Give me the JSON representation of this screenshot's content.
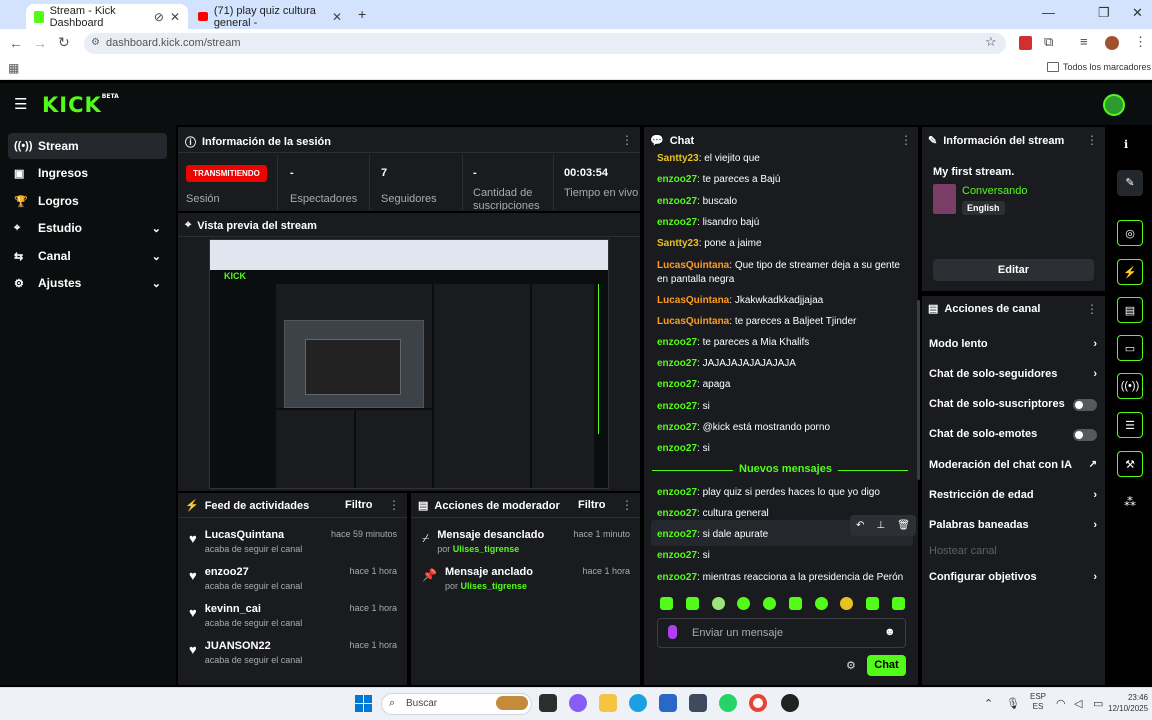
{
  "browser": {
    "tabs": [
      {
        "title": "Stream - Kick Dashboard"
      },
      {
        "title": "(71) play quiz cultura general -"
      }
    ],
    "url": "dashboard.kick.com/stream",
    "bookmarks_label": "Todos los marcadores"
  },
  "kick": {
    "logo": "KICK",
    "beta": "BETA"
  },
  "nav": [
    {
      "label": "Stream",
      "icon": "stream-icon"
    },
    {
      "label": "Ingresos",
      "icon": "revenue-icon"
    },
    {
      "label": "Logros",
      "icon": "trophy-icon"
    },
    {
      "label": "Estudio",
      "icon": "studio-icon"
    },
    {
      "label": "Canal",
      "icon": "channel-icon"
    },
    {
      "label": "Ajustes",
      "icon": "gear-icon"
    }
  ],
  "session": {
    "title": "Información de la sesión",
    "status_badge": "TRANSMITIENDO",
    "status_label": "Sesión",
    "stats": [
      {
        "value": "-",
        "label": "Espectadores"
      },
      {
        "value": "7",
        "label": "Seguidores"
      },
      {
        "value": "-",
        "label": "Cantidad de suscripciones"
      },
      {
        "value": "00:03:54",
        "label": "Tiempo en vivo"
      }
    ]
  },
  "preview": {
    "title": "Vista previa del stream"
  },
  "feed": {
    "title": "Feed de actividades",
    "filter": "Filtro",
    "items": [
      {
        "name": "LucasQuintana",
        "sub": "acaba de seguir el canal",
        "time": "hace 59 minutos"
      },
      {
        "name": "enzoo27",
        "sub": "acaba de seguir el canal",
        "time": "hace 1 hora"
      },
      {
        "name": "kevinn_cai",
        "sub": "acaba de seguir el canal",
        "time": "hace 1 hora"
      },
      {
        "name": "JUANSON22",
        "sub": "acaba de seguir el canal",
        "time": "hace 1 hora"
      }
    ]
  },
  "mod": {
    "title": "Acciones de moderador",
    "filter": "Filtro",
    "items": [
      {
        "action": "Mensaje desanclado",
        "by": "por",
        "user": "Ulises_tigrense",
        "time": "hace 1 minuto"
      },
      {
        "action": "Mensaje anclado",
        "by": "por",
        "user": "Ulises_tigrense",
        "time": "hace 1 hora"
      }
    ]
  },
  "chat": {
    "title": "Chat",
    "messages": [
      {
        "user": "Santty23",
        "text": "el viejito que"
      },
      {
        "user": "enzoo27",
        "text": "te pareces a Bajú"
      },
      {
        "user": "enzoo27",
        "text": "buscalo"
      },
      {
        "user": "enzoo27",
        "text": "lisandro bajú"
      },
      {
        "user": "Santty23",
        "text": "pone a jaime"
      },
      {
        "user": "LucasQuintana",
        "text": "Que tipo de streamer deja a su gente en pantalla negra"
      },
      {
        "user": "LucasQuintana",
        "text": "Jkakwkadkkadjjajaa"
      },
      {
        "user": "LucasQuintana",
        "text": "te pareces a Baljeet Tjinder"
      },
      {
        "user": "enzoo27",
        "text": "te pareces a Mia Khalifs"
      },
      {
        "user": "enzoo27",
        "text": "JAJAJAJAJAJAJAJA"
      },
      {
        "user": "enzoo27",
        "text": "apaga"
      },
      {
        "user": "enzoo27",
        "text": "si"
      },
      {
        "user": "enzoo27",
        "text": "@kick está mostrando porno"
      },
      {
        "user": "enzoo27",
        "text": "si"
      }
    ],
    "new_divider": "Nuevos mensajes",
    "new_messages": [
      {
        "user": "enzoo27",
        "text": "play quiz si perdes haces lo que yo digo"
      },
      {
        "user": "enzoo27",
        "text": "cultura general"
      },
      {
        "user": "enzoo27",
        "text": "si dale apurate"
      },
      {
        "user": "enzoo27",
        "text": "si"
      },
      {
        "user": "enzoo27",
        "text": "mientras reacciona a la presidencia de Perón"
      }
    ],
    "input_placeholder": "Enviar un mensaje",
    "send_label": "Chat"
  },
  "stream_info": {
    "title": "Información del stream",
    "stream_title": "My first stream.",
    "category": "Conversando",
    "language": "English",
    "edit_label": "Editar"
  },
  "channel_actions": {
    "title": "Acciones de canal",
    "items": [
      {
        "label": "Modo lento",
        "control": "chevron"
      },
      {
        "label": "Chat de solo-seguidores",
        "control": "chevron"
      },
      {
        "label": "Chat de solo-suscriptores",
        "control": "toggle"
      },
      {
        "label": "Chat de solo-emotes",
        "control": "toggle"
      },
      {
        "label": "Moderación del chat con IA",
        "control": "external"
      },
      {
        "label": "Restricción de edad",
        "control": "chevron"
      },
      {
        "label": "Palabras baneadas",
        "control": "chevron"
      },
      {
        "label": "Hostear canal",
        "control": "disabled"
      },
      {
        "label": "Configurar objetivos",
        "control": "chevron"
      }
    ]
  },
  "taskbar": {
    "search_placeholder": "Buscar",
    "lang_top": "ESP",
    "lang_bottom": "ES",
    "time": "23:46",
    "date": "12/10/2025"
  },
  "colors": {
    "accent": "#53fc18",
    "live": "#eb0400",
    "panel": "#191b1f",
    "bg": "#0b0e0f"
  }
}
